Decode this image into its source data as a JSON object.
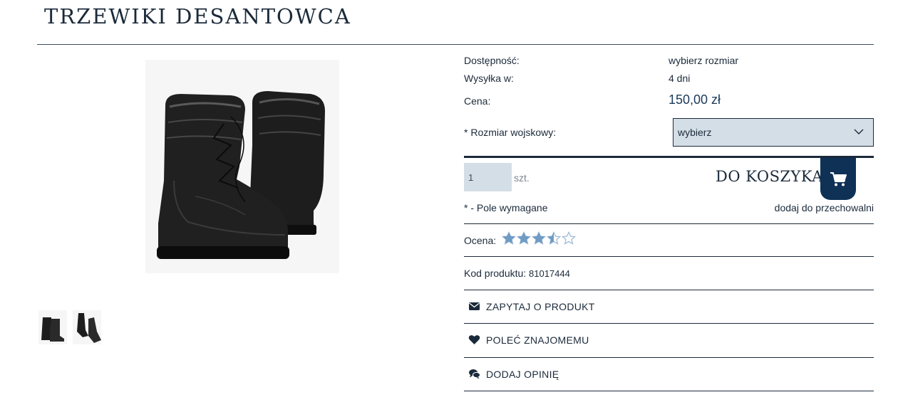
{
  "product": {
    "title": "TRZEWIKI DESANTOWCA",
    "images": {
      "main": "black-leather-boots-pair",
      "thumbs": [
        "boots-thumb-1",
        "boots-thumb-2"
      ]
    }
  },
  "details": {
    "availability_label": "Dostępność:",
    "availability_value": "wybierz rozmiar",
    "shipping_label": "Wysyłka w:",
    "shipping_value": "4 dni",
    "price_label": "Cena:",
    "price_value": "150,00 zł",
    "size_label": "* Rozmiar wojskowy:",
    "size_selected": "wybierz"
  },
  "cart": {
    "quantity": "1",
    "unit": "szt.",
    "add_label": "DO KOSZYKA",
    "cart_icon": "shopping-cart-icon",
    "required_note": "* - Pole wymagane",
    "store_link": "dodaj do przechowalni"
  },
  "rating": {
    "label": "Ocena:",
    "value": 3.5,
    "max": 5,
    "star_color": "#6f9bc4",
    "empty_color": "#9fbbd6"
  },
  "code": {
    "label": "Kod produktu:",
    "value": "81017444"
  },
  "actions": [
    {
      "label": "ZAPYTAJ O PRODUKT",
      "icon": "envelope-icon"
    },
    {
      "label": "POLEĆ ZNAJOMEMU",
      "icon": "heart-icon"
    },
    {
      "label": "DODAJ OPINIĘ",
      "icon": "comments-icon"
    }
  ],
  "colors": {
    "accent": "#0f3156",
    "field_bg": "#d4dee7",
    "text": "#1b2a3a"
  }
}
